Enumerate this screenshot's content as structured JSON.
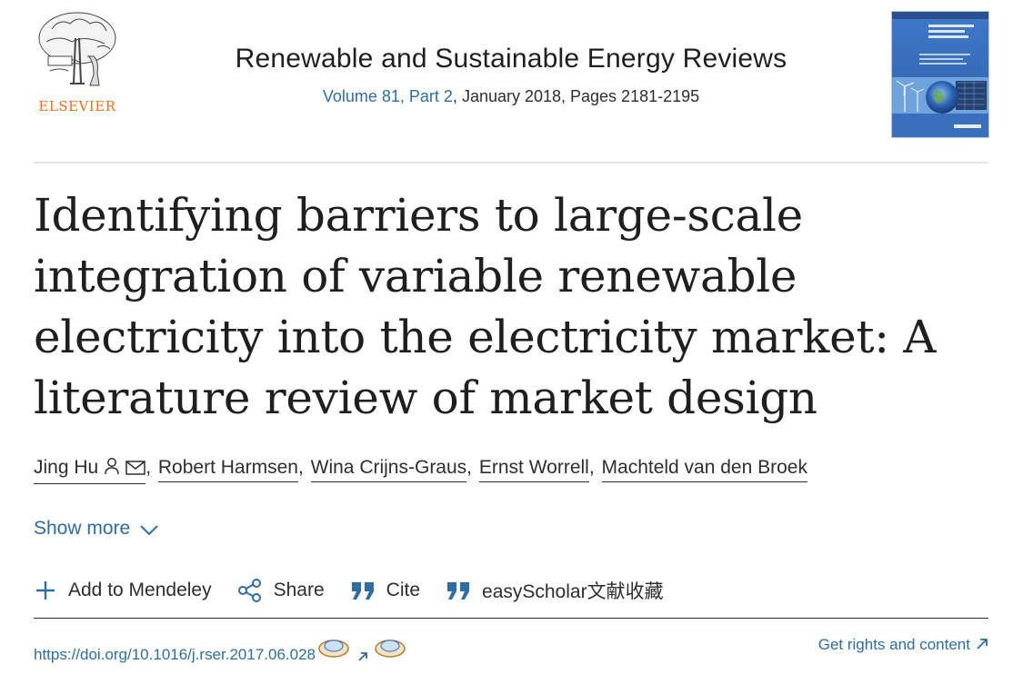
{
  "header": {
    "publisher_logo_text": "ELSEVIER",
    "journal_title": "Renewable and Sustainable Energy Reviews",
    "volume_link": "Volume 81, Part 2",
    "issue_info": ", January 2018, Pages 2181-2195",
    "cover_title": "Renewable & Sustainable Energy Reviews"
  },
  "article": {
    "title": "Identifying barriers to large-scale integration of variable renewable electricity into the electricity market: A literature review of market design"
  },
  "authors": [
    {
      "name": "Jing Hu"
    },
    {
      "name": "Robert Harmsen"
    },
    {
      "name": "Wina Crijns-Graus"
    },
    {
      "name": "Ernst Worrell"
    },
    {
      "name": "Machteld van den Broek"
    }
  ],
  "author_separator": ",",
  "show_more": "Show more",
  "actions": {
    "add_to_mendeley": "Add to Mendeley",
    "share": "Share",
    "cite": "Cite",
    "easyscholar": "easyScholar文献收藏"
  },
  "doi": "https://doi.org/10.1016/j.rser.2017.06.028",
  "rights": "Get rights and content",
  "colors": {
    "link": "#2e6da4",
    "elsevier_orange": "#e9711c",
    "text": "#1f1f1f"
  }
}
